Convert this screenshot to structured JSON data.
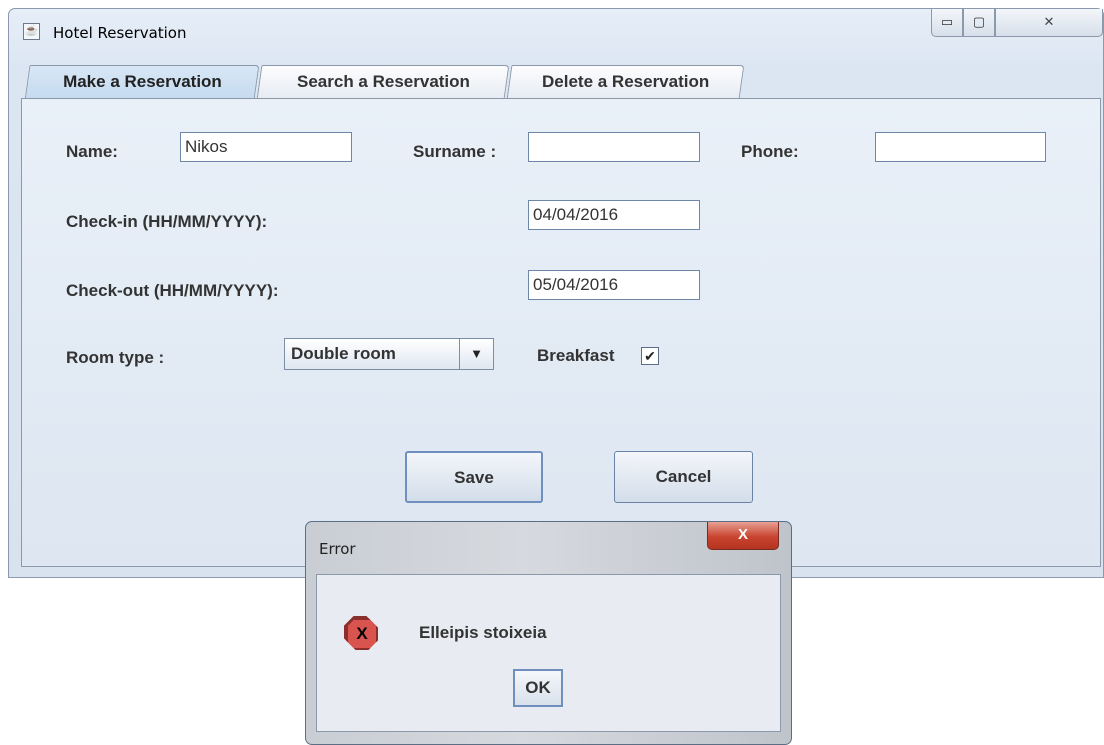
{
  "window": {
    "title": "Hotel Reservation",
    "controls": {
      "minimize": "▭",
      "maximize": "▢",
      "close": "✕"
    }
  },
  "tabs": [
    {
      "label": "Make a Reservation",
      "active": true
    },
    {
      "label": "Search a Reservation",
      "active": false
    },
    {
      "label": "Delete a Reservation",
      "active": false
    }
  ],
  "form": {
    "name_label": "Name:",
    "name_value": "Nikos",
    "surname_label": "Surname :",
    "surname_value": "",
    "phone_label": "Phone:",
    "phone_value": "",
    "checkin_label": "Check-in (HH/MM/YYYY):",
    "checkin_value": "04/04/2016",
    "checkout_label": "Check-out (HH/MM/YYYY):",
    "checkout_value": "05/04/2016",
    "roomtype_label": "Room type :",
    "roomtype_value": "Double room",
    "breakfast_label": "Breakfast",
    "breakfast_checked": true,
    "save_label": "Save",
    "cancel_label": "Cancel"
  },
  "dialog": {
    "title": "Error",
    "message": "Elleipis stoixeia",
    "ok_label": "OK",
    "icon": "error-icon"
  },
  "colors": {
    "panel_bg": "#e9f0f8",
    "active_tab": "#c4daf0",
    "close_button": "#c8442f",
    "error_icon": "#d9534f"
  }
}
